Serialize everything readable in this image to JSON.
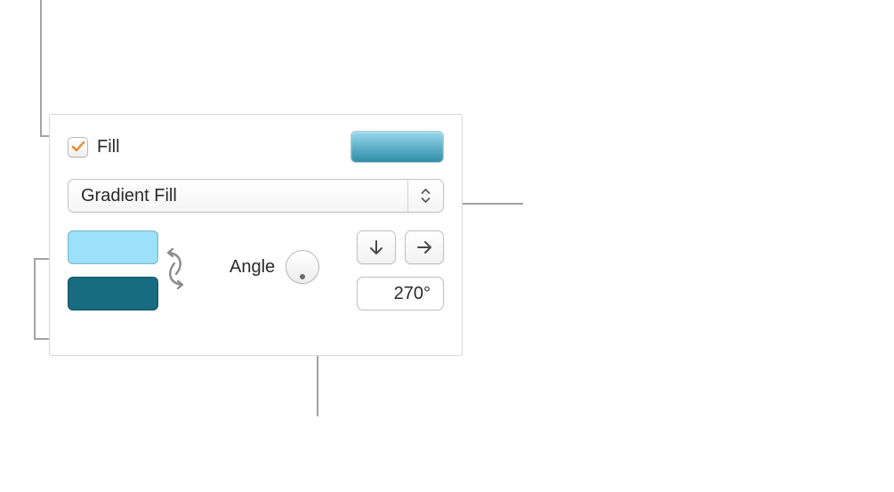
{
  "fill": {
    "checkbox_checked": true,
    "label": "Fill",
    "preview_gradient": [
      "#97d8ed",
      "#2f8ca7"
    ]
  },
  "dropdown": {
    "selected": "Gradient Fill"
  },
  "swatches": {
    "color1": "#9ce1f9",
    "color2": "#176c81"
  },
  "angle": {
    "label": "Angle",
    "value": "270°"
  },
  "icons": {
    "checkmark": "checkmark-icon",
    "dropdown_arrows": "updown-chevron-icon",
    "swap": "swap-icon",
    "direction_down": "arrow-down-icon",
    "direction_right": "arrow-right-icon"
  }
}
